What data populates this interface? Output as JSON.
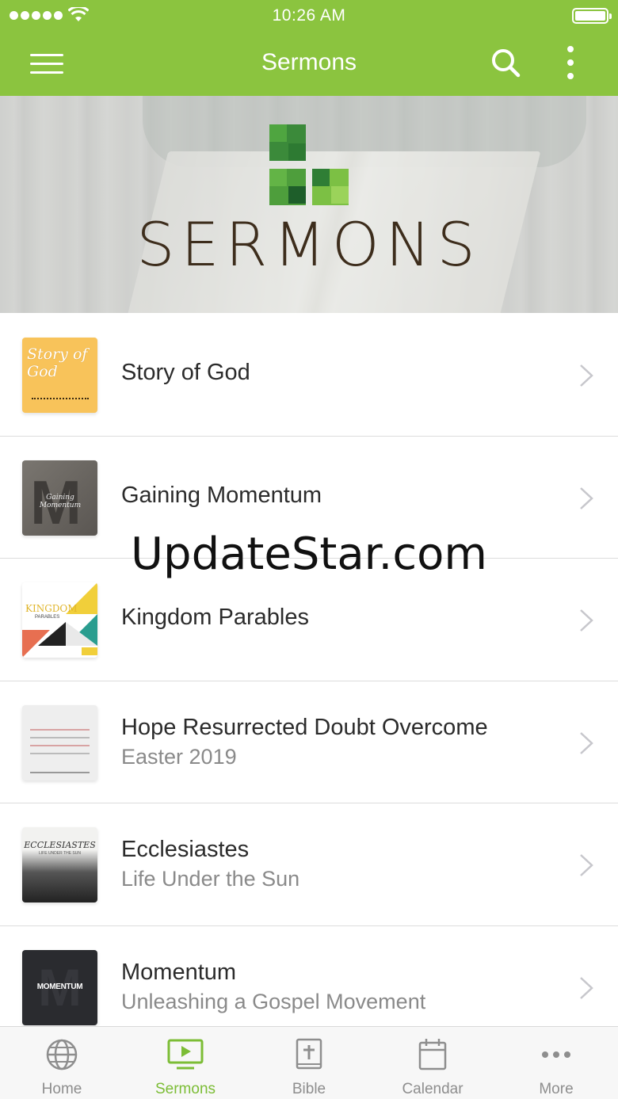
{
  "status_bar": {
    "time": "10:26 AM"
  },
  "nav": {
    "title": "Sermons"
  },
  "hero": {
    "text": "SERMONS"
  },
  "watermark": "UpdateStar.com",
  "sermons": [
    {
      "title": "Story of God",
      "subtitle": "",
      "thumb_icon": "story-of-god-artwork"
    },
    {
      "title": "Gaining Momentum",
      "subtitle": "",
      "thumb_icon": "gaining-momentum-artwork"
    },
    {
      "title": "Kingdom Parables",
      "subtitle": "",
      "thumb_icon": "kingdom-parables-artwork"
    },
    {
      "title": "Hope Resurrected Doubt Overcome",
      "subtitle": "Easter 2019",
      "thumb_icon": "hope-resurrected-artwork"
    },
    {
      "title": "Ecclesiastes",
      "subtitle": "Life Under the Sun",
      "thumb_icon": "ecclesiastes-artwork"
    },
    {
      "title": "Momentum",
      "subtitle": "Unleashing a Gospel Movement",
      "thumb_icon": "momentum-artwork"
    }
  ],
  "thumb_text": {
    "story": "Story of God",
    "gaining": "Gaining Momentum",
    "kingdom": "KINGDOM",
    "kingdom_sub": "PARABLES",
    "ecclesiastes": "ECCLESIASTES",
    "ecclesiastes_sub": "LIFE UNDER THE SUN",
    "momentum": "MOMENTUM"
  },
  "tabs": [
    {
      "label": "Home",
      "icon": "globe-icon",
      "active": false
    },
    {
      "label": "Sermons",
      "icon": "tv-play-icon",
      "active": true
    },
    {
      "label": "Bible",
      "icon": "bible-icon",
      "active": false
    },
    {
      "label": "Calendar",
      "icon": "calendar-icon",
      "active": false
    },
    {
      "label": "More",
      "icon": "more-dots-icon",
      "active": false
    }
  ],
  "colors": {
    "brand_green": "#8bc43f",
    "active_tab": "#7cbd36",
    "inactive_tab": "#8e8e8e"
  }
}
